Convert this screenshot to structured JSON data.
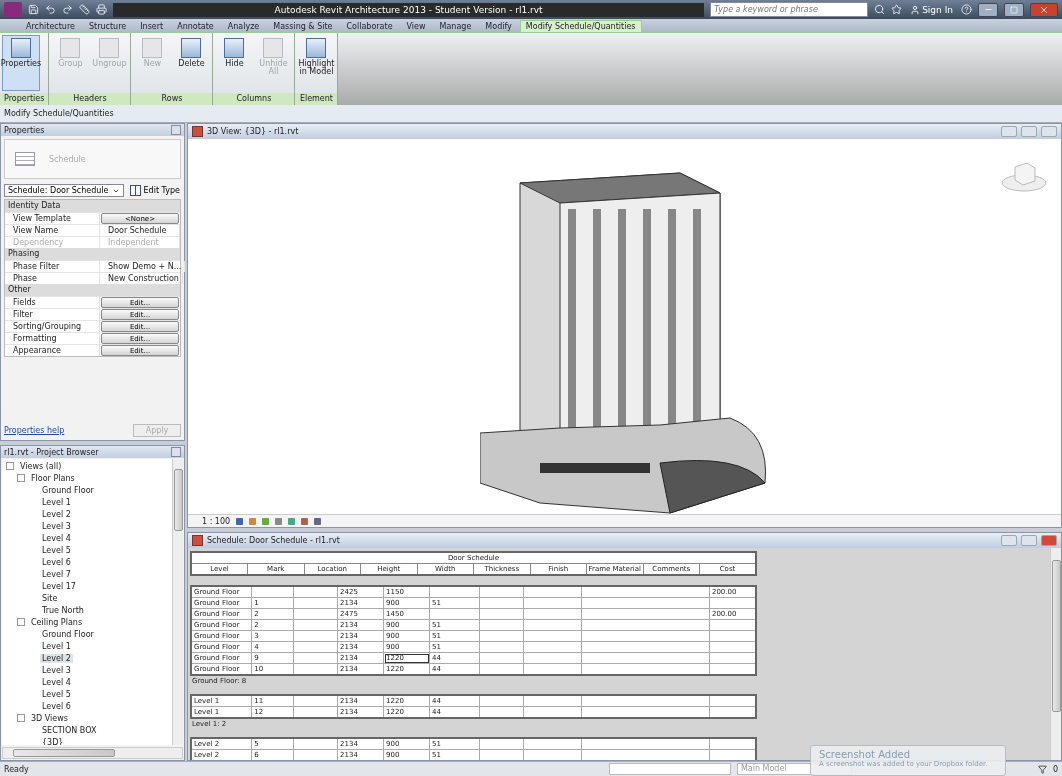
{
  "window": {
    "title": "Autodesk Revit Architecture 2013 - Student Version - rl1.rvt",
    "search_placeholder": "Type a keyword or phrase",
    "sign_in": "Sign In"
  },
  "tabs": [
    {
      "label": "Architecture",
      "selected": false
    },
    {
      "label": "Structure",
      "selected": false
    },
    {
      "label": "Insert",
      "selected": false
    },
    {
      "label": "Annotate",
      "selected": false
    },
    {
      "label": "Analyze",
      "selected": false
    },
    {
      "label": "Massing & Site",
      "selected": false
    },
    {
      "label": "Collaborate",
      "selected": false
    },
    {
      "label": "View",
      "selected": false
    },
    {
      "label": "Manage",
      "selected": false
    },
    {
      "label": "Modify",
      "selected": false
    },
    {
      "label": "Modify Schedule/Quantities",
      "selected": true
    }
  ],
  "ribbon": [
    {
      "panel": "Properties",
      "tools": [
        {
          "label": "Properties",
          "disabled": false,
          "selected": true
        }
      ]
    },
    {
      "panel": "Headers",
      "tools": [
        {
          "label": "Group",
          "disabled": true,
          "selected": false
        },
        {
          "label": "Ungroup",
          "disabled": true,
          "selected": false
        }
      ]
    },
    {
      "panel": "Rows",
      "tools": [
        {
          "label": "New",
          "disabled": true,
          "selected": false
        },
        {
          "label": "Delete",
          "disabled": false,
          "selected": false
        }
      ]
    },
    {
      "panel": "Columns",
      "tools": [
        {
          "label": "Hide",
          "disabled": false,
          "selected": false
        },
        {
          "label": "Unhide All",
          "disabled": true,
          "selected": false
        }
      ]
    },
    {
      "panel": "Element",
      "tools": [
        {
          "label": "Highlight in Model",
          "disabled": false,
          "selected": false
        }
      ]
    }
  ],
  "context_bar": "Modify Schedule/Quantities",
  "properties": {
    "title": "Properties",
    "type_name": "Schedule",
    "instance": "Schedule: Door Schedule",
    "edit_type": "Edit Type",
    "groups": [
      {
        "name": "Identity Data",
        "rows": [
          {
            "kind": "button",
            "label": "View Template",
            "value": "<None>",
            "disabled": false
          },
          {
            "kind": "text",
            "label": "View Name",
            "value": "Door Schedule",
            "disabled": false
          },
          {
            "kind": "text",
            "label": "Dependency",
            "value": "Independent",
            "disabled": true
          }
        ]
      },
      {
        "name": "Phasing",
        "rows": [
          {
            "kind": "text",
            "label": "Phase Filter",
            "value": "Show Demo + N...",
            "disabled": false
          },
          {
            "kind": "text",
            "label": "Phase",
            "value": "New Construction",
            "disabled": false
          }
        ]
      },
      {
        "name": "Other",
        "rows": [
          {
            "kind": "button",
            "label": "Fields",
            "value": "Edit...",
            "disabled": false
          },
          {
            "kind": "button",
            "label": "Filter",
            "value": "Edit...",
            "disabled": false
          },
          {
            "kind": "button",
            "label": "Sorting/Grouping",
            "value": "Edit...",
            "disabled": false
          },
          {
            "kind": "button",
            "label": "Formatting",
            "value": "Edit...",
            "disabled": false
          },
          {
            "kind": "button",
            "label": "Appearance",
            "value": "Edit...",
            "disabled": false
          }
        ]
      }
    ],
    "help": "Properties help",
    "apply": "Apply"
  },
  "browser": {
    "title": "rl1.rvt - Project Browser",
    "tree": [
      {
        "label": "Views (all)",
        "expanded": true,
        "selected": false,
        "children": [
          {
            "label": "Floor Plans",
            "expanded": true,
            "selected": false,
            "children": [
              {
                "label": "Ground Floor",
                "selected": false
              },
              {
                "label": "Level 1",
                "selected": false
              },
              {
                "label": "Level 2",
                "selected": false
              },
              {
                "label": "Level 3",
                "selected": false
              },
              {
                "label": "Level 4",
                "selected": false
              },
              {
                "label": "Level 5",
                "selected": false
              },
              {
                "label": "Level 6",
                "selected": false
              },
              {
                "label": "Level 7",
                "selected": false
              },
              {
                "label": "Level 17",
                "selected": false
              },
              {
                "label": "Site",
                "selected": false
              },
              {
                "label": "True North",
                "selected": false
              }
            ]
          },
          {
            "label": "Ceiling Plans",
            "expanded": true,
            "selected": false,
            "children": [
              {
                "label": "Ground Floor",
                "selected": false
              },
              {
                "label": "Level 1",
                "selected": false
              },
              {
                "label": "Level 2",
                "selected": true
              },
              {
                "label": "Level 3",
                "selected": false
              },
              {
                "label": "Level 4",
                "selected": false
              },
              {
                "label": "Level 5",
                "selected": false
              },
              {
                "label": "Level 6",
                "selected": false
              }
            ]
          },
          {
            "label": "3D Views",
            "expanded": true,
            "selected": false,
            "children": [
              {
                "label": "SECTION BOX",
                "selected": false
              },
              {
                "label": "{3D}",
                "selected": false
              }
            ]
          }
        ]
      }
    ]
  },
  "view3d": {
    "title": "3D View: {3D} - rl1.rvt",
    "scale": "1 : 100"
  },
  "schedule": {
    "window_title": "Schedule: Door Schedule - rl1.rvt",
    "title": "Door Schedule",
    "columns": [
      "Level",
      "Mark",
      "Location",
      "Height",
      "Width",
      "Thickness",
      "Finish",
      "Frame Material",
      "Comments",
      "Cost"
    ],
    "groups": [
      {
        "footer": "Ground Floor: 8",
        "rows": [
          [
            {
              "text": "Ground Floor",
              "selected": false
            },
            {
              "selected": false
            },
            {
              "selected": false
            },
            {
              "text": "2425",
              "selected": false
            },
            {
              "text": "1150",
              "selected": false
            },
            {
              "selected": false
            },
            {
              "selected": false
            },
            {
              "selected": false
            },
            {
              "selected": false
            },
            {
              "text": "200.00",
              "selected": false
            }
          ],
          [
            {
              "text": "Ground Floor",
              "selected": false
            },
            {
              "text": "1",
              "selected": false
            },
            {
              "selected": false
            },
            {
              "text": "2134",
              "selected": false
            },
            {
              "text": "900",
              "selected": false
            },
            {
              "text": "51",
              "selected": false
            },
            {
              "selected": false
            },
            {
              "selected": false
            },
            {
              "selected": false
            },
            {
              "selected": false
            }
          ],
          [
            {
              "text": "Ground Floor",
              "selected": false
            },
            {
              "text": "2",
              "selected": false
            },
            {
              "selected": false
            },
            {
              "text": "2475",
              "selected": false
            },
            {
              "text": "1450",
              "selected": false
            },
            {
              "selected": false
            },
            {
              "selected": false
            },
            {
              "selected": false
            },
            {
              "selected": false
            },
            {
              "text": "200.00",
              "selected": false
            }
          ],
          [
            {
              "text": "Ground Floor",
              "selected": false
            },
            {
              "text": "2",
              "selected": false
            },
            {
              "selected": false
            },
            {
              "text": "2134",
              "selected": false
            },
            {
              "text": "900",
              "selected": false
            },
            {
              "text": "51",
              "selected": false
            },
            {
              "selected": false
            },
            {
              "selected": false
            },
            {
              "selected": false
            },
            {
              "selected": false
            }
          ],
          [
            {
              "text": "Ground Floor",
              "selected": false
            },
            {
              "text": "3",
              "selected": false
            },
            {
              "selected": false
            },
            {
              "text": "2134",
              "selected": false
            },
            {
              "text": "900",
              "selected": false
            },
            {
              "text": "51",
              "selected": false
            },
            {
              "selected": false
            },
            {
              "selected": false
            },
            {
              "selected": false
            },
            {
              "selected": false
            }
          ],
          [
            {
              "text": "Ground Floor",
              "selected": false
            },
            {
              "text": "4",
              "selected": false
            },
            {
              "selected": false
            },
            {
              "text": "2134",
              "selected": false
            },
            {
              "text": "900",
              "selected": false
            },
            {
              "text": "51",
              "selected": false
            },
            {
              "selected": false
            },
            {
              "selected": false
            },
            {
              "selected": false
            },
            {
              "selected": false
            }
          ],
          [
            {
              "text": "Ground Floor",
              "selected": false
            },
            {
              "text": "9",
              "selected": false
            },
            {
              "selected": false
            },
            {
              "text": "2134",
              "selected": false
            },
            {
              "text": "1220",
              "selected": true
            },
            {
              "text": "44",
              "selected": false
            },
            {
              "selected": false
            },
            {
              "selected": false
            },
            {
              "selected": false
            },
            {
              "selected": false
            }
          ],
          [
            {
              "text": "Ground Floor",
              "selected": false
            },
            {
              "text": "10",
              "selected": false
            },
            {
              "selected": false
            },
            {
              "text": "2134",
              "selected": false
            },
            {
              "text": "1220",
              "selected": false
            },
            {
              "text": "44",
              "selected": false
            },
            {
              "selected": false
            },
            {
              "selected": false
            },
            {
              "selected": false
            },
            {
              "selected": false
            }
          ]
        ]
      },
      {
        "footer": "Level 1: 2",
        "rows": [
          [
            {
              "text": "Level 1",
              "selected": false
            },
            {
              "text": "11",
              "selected": false
            },
            {
              "selected": false
            },
            {
              "text": "2134",
              "selected": false
            },
            {
              "text": "1220",
              "selected": false
            },
            {
              "text": "44",
              "selected": false
            },
            {
              "selected": false
            },
            {
              "selected": false
            },
            {
              "selected": false
            },
            {
              "selected": false
            }
          ],
          [
            {
              "text": "Level 1",
              "selected": false
            },
            {
              "text": "12",
              "selected": false
            },
            {
              "selected": false
            },
            {
              "text": "2134",
              "selected": false
            },
            {
              "text": "1220",
              "selected": false
            },
            {
              "text": "44",
              "selected": false
            },
            {
              "selected": false
            },
            {
              "selected": false
            },
            {
              "selected": false
            },
            {
              "selected": false
            }
          ]
        ]
      },
      {
        "rows": [
          [
            {
              "text": "Level 2",
              "selected": false
            },
            {
              "text": "5",
              "selected": false
            },
            {
              "selected": false
            },
            {
              "text": "2134",
              "selected": false
            },
            {
              "text": "900",
              "selected": false
            },
            {
              "text": "51",
              "selected": false
            },
            {
              "selected": false
            },
            {
              "selected": false
            },
            {
              "selected": false
            },
            {
              "selected": false
            }
          ],
          [
            {
              "text": "Level 2",
              "selected": false
            },
            {
              "text": "6",
              "selected": false
            },
            {
              "selected": false
            },
            {
              "text": "2134",
              "selected": false
            },
            {
              "text": "900",
              "selected": false
            },
            {
              "text": "51",
              "selected": false
            },
            {
              "selected": false
            },
            {
              "selected": false
            },
            {
              "selected": false
            },
            {
              "selected": false
            }
          ]
        ]
      }
    ]
  },
  "status_bar": {
    "text": "Ready",
    "model": "Main Model",
    "filter_count": "0"
  },
  "notification": {
    "title": "Screenshot Added",
    "message": "A screenshot was added to your Dropbox folder."
  }
}
